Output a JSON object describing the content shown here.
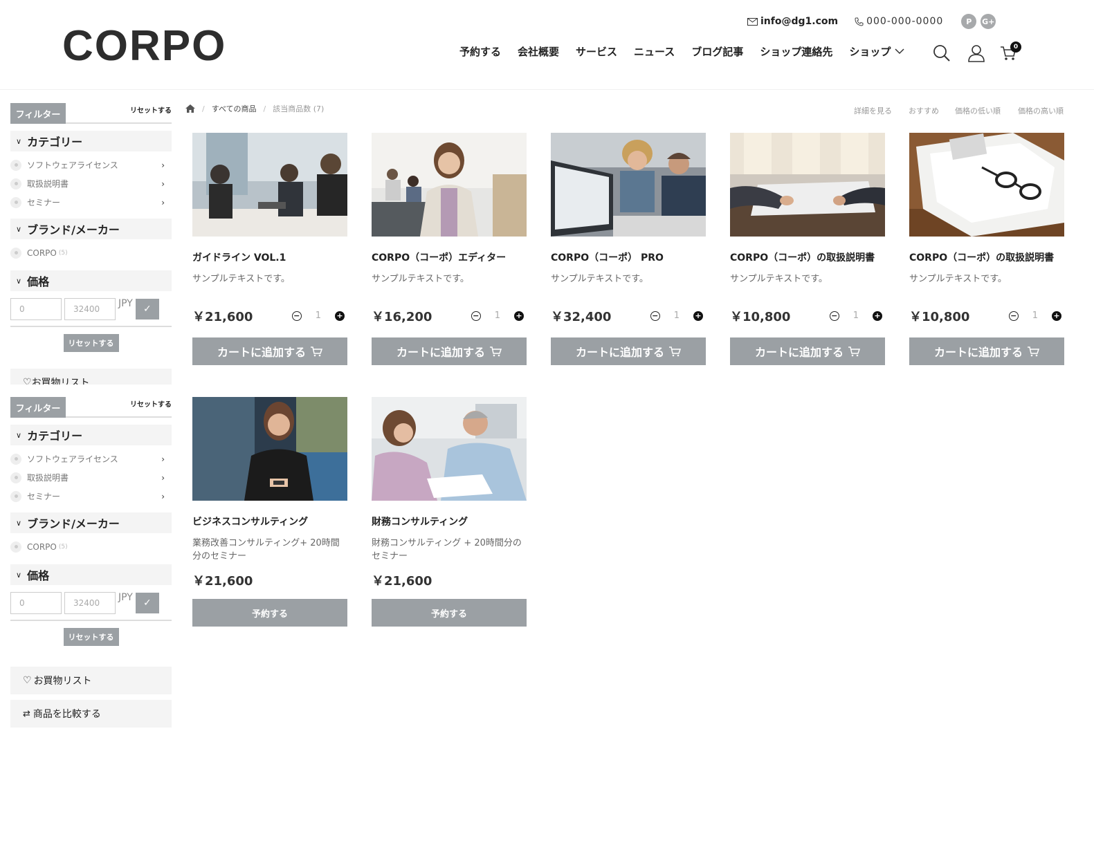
{
  "header": {
    "logo": "CORPO",
    "email": "info@dg1.com",
    "phone": "000-000-0000",
    "social": [
      "P",
      "G+"
    ],
    "nav": [
      "予約する",
      "会社概要",
      "サービス",
      "ニュース",
      "ブログ記事",
      "ショップ連絡先",
      "ショップ"
    ],
    "cart_count": "0"
  },
  "breadcrumb": {
    "all_products": "すべての商品",
    "count": "該当商品数 (7)"
  },
  "sort": [
    "詳細を見る",
    "おすすめ",
    "価格の低い順",
    "価格の高い順"
  ],
  "filter": {
    "label": "フィルター",
    "reset": "リセットする",
    "category_title": "カテゴリー",
    "categories": [
      "ソフトウェアライセンス",
      "取扱説明書",
      "セミナー"
    ],
    "brand_title": "ブランド/メーカー",
    "brand": "CORPO",
    "brand_count": "(5)",
    "price_title": "価格",
    "price_min": "0",
    "price_max": "32400",
    "currency": "JPY",
    "reset_button": "リセットする"
  },
  "wishlist": "お買物リスト",
  "compare": "商品を比較する",
  "products": [
    {
      "title": "ガイドライン VOL.1",
      "desc": "サンプルテキストです。",
      "price": "￥21,600",
      "qty": "1",
      "button": "カートに追加する"
    },
    {
      "title": "CORPO（コーポ）エディター",
      "desc": "サンプルテキストです。",
      "price": "￥16,200",
      "qty": "1",
      "button": "カートに追加する"
    },
    {
      "title": "CORPO（コーポ） PRO",
      "desc": "サンプルテキストです。",
      "price": "￥32,400",
      "qty": "1",
      "button": "カートに追加する"
    },
    {
      "title": "CORPO（コーポ）の取扱説明書",
      "desc": "サンプルテキストです。",
      "price": "￥10,800",
      "qty": "1",
      "button": "カートに追加する"
    },
    {
      "title": "CORPO（コーポ）の取扱説明書",
      "desc": "サンプルテキストです。",
      "price": "￥10,800",
      "qty": "1",
      "button": "カートに追加する"
    },
    {
      "title": "ビジネスコンサルティング",
      "desc": "業務改善コンサルティング+ 20時間分のセミナー",
      "price": "￥21,600",
      "button": "予約する"
    },
    {
      "title": "財務コンサルティング",
      "desc": "財務コンサルティング + 20時間分のセミナー",
      "price": "￥21,600",
      "button": "予約する"
    }
  ],
  "colors": {
    "button": "#9ba0a4",
    "panel": "#f4f4f4"
  }
}
